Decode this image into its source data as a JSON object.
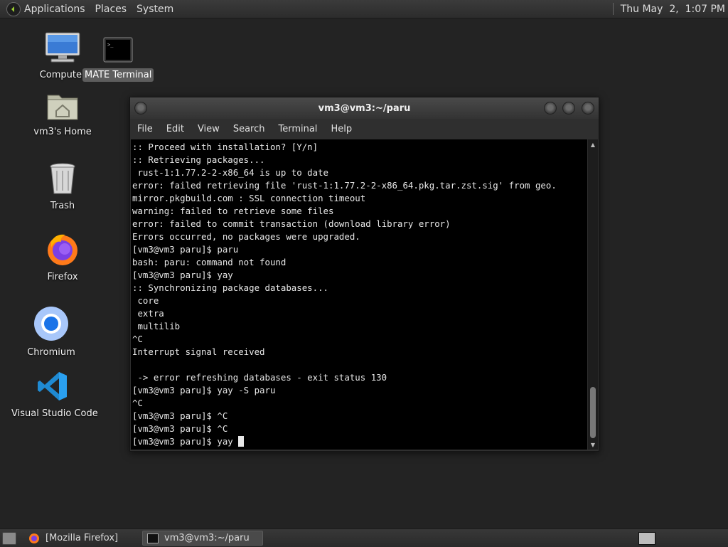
{
  "top_panel": {
    "menus": [
      "Applications",
      "Places",
      "System"
    ],
    "clock": "Thu May  2,  1:07 PM"
  },
  "desktop": {
    "icons": [
      {
        "label": "Computer"
      },
      {
        "label": "MATE Terminal"
      },
      {
        "label": "vm3's Home"
      },
      {
        "label": "Trash"
      },
      {
        "label": "Firefox"
      },
      {
        "label": "Chromium"
      },
      {
        "label": "Visual Studio Code"
      }
    ]
  },
  "terminal_window": {
    "title": "vm3@vm3:~/paru",
    "menu": [
      "File",
      "Edit",
      "View",
      "Search",
      "Terminal",
      "Help"
    ],
    "lines": [
      ":: Proceed with installation? [Y/n]",
      ":: Retrieving packages...",
      " rust-1:1.77.2-2-x86_64 is up to date",
      "error: failed retrieving file 'rust-1:1.77.2-2-x86_64.pkg.tar.zst.sig' from geo.",
      "mirror.pkgbuild.com : SSL connection timeout",
      "warning: failed to retrieve some files",
      "error: failed to commit transaction (download library error)",
      "Errors occurred, no packages were upgraded.",
      "[vm3@vm3 paru]$ paru",
      "bash: paru: command not found",
      "[vm3@vm3 paru]$ yay",
      ":: Synchronizing package databases...",
      " core",
      " extra",
      " multilib",
      "^C",
      "Interrupt signal received",
      "",
      " -> error refreshing databases - exit status 130",
      "[vm3@vm3 paru]$ yay -S paru",
      "^C",
      "[vm3@vm3 paru]$ ^C",
      "[vm3@vm3 paru]$ ^C"
    ],
    "prompt_line": "[vm3@vm3 paru]$ yay "
  },
  "taskbar": {
    "tasks": [
      {
        "label": "[Mozilla Firefox]",
        "active": false
      },
      {
        "label": "vm3@vm3:~/paru",
        "active": true
      }
    ]
  },
  "colors": {
    "desktop_bg": "#232323",
    "terminal_bg": "#000000",
    "terminal_fg": "#e8e8e8",
    "firefox_orange": "#ff7a1a",
    "chromium_blue": "#1a73e8",
    "vscode_blue": "#1f8ad2"
  }
}
